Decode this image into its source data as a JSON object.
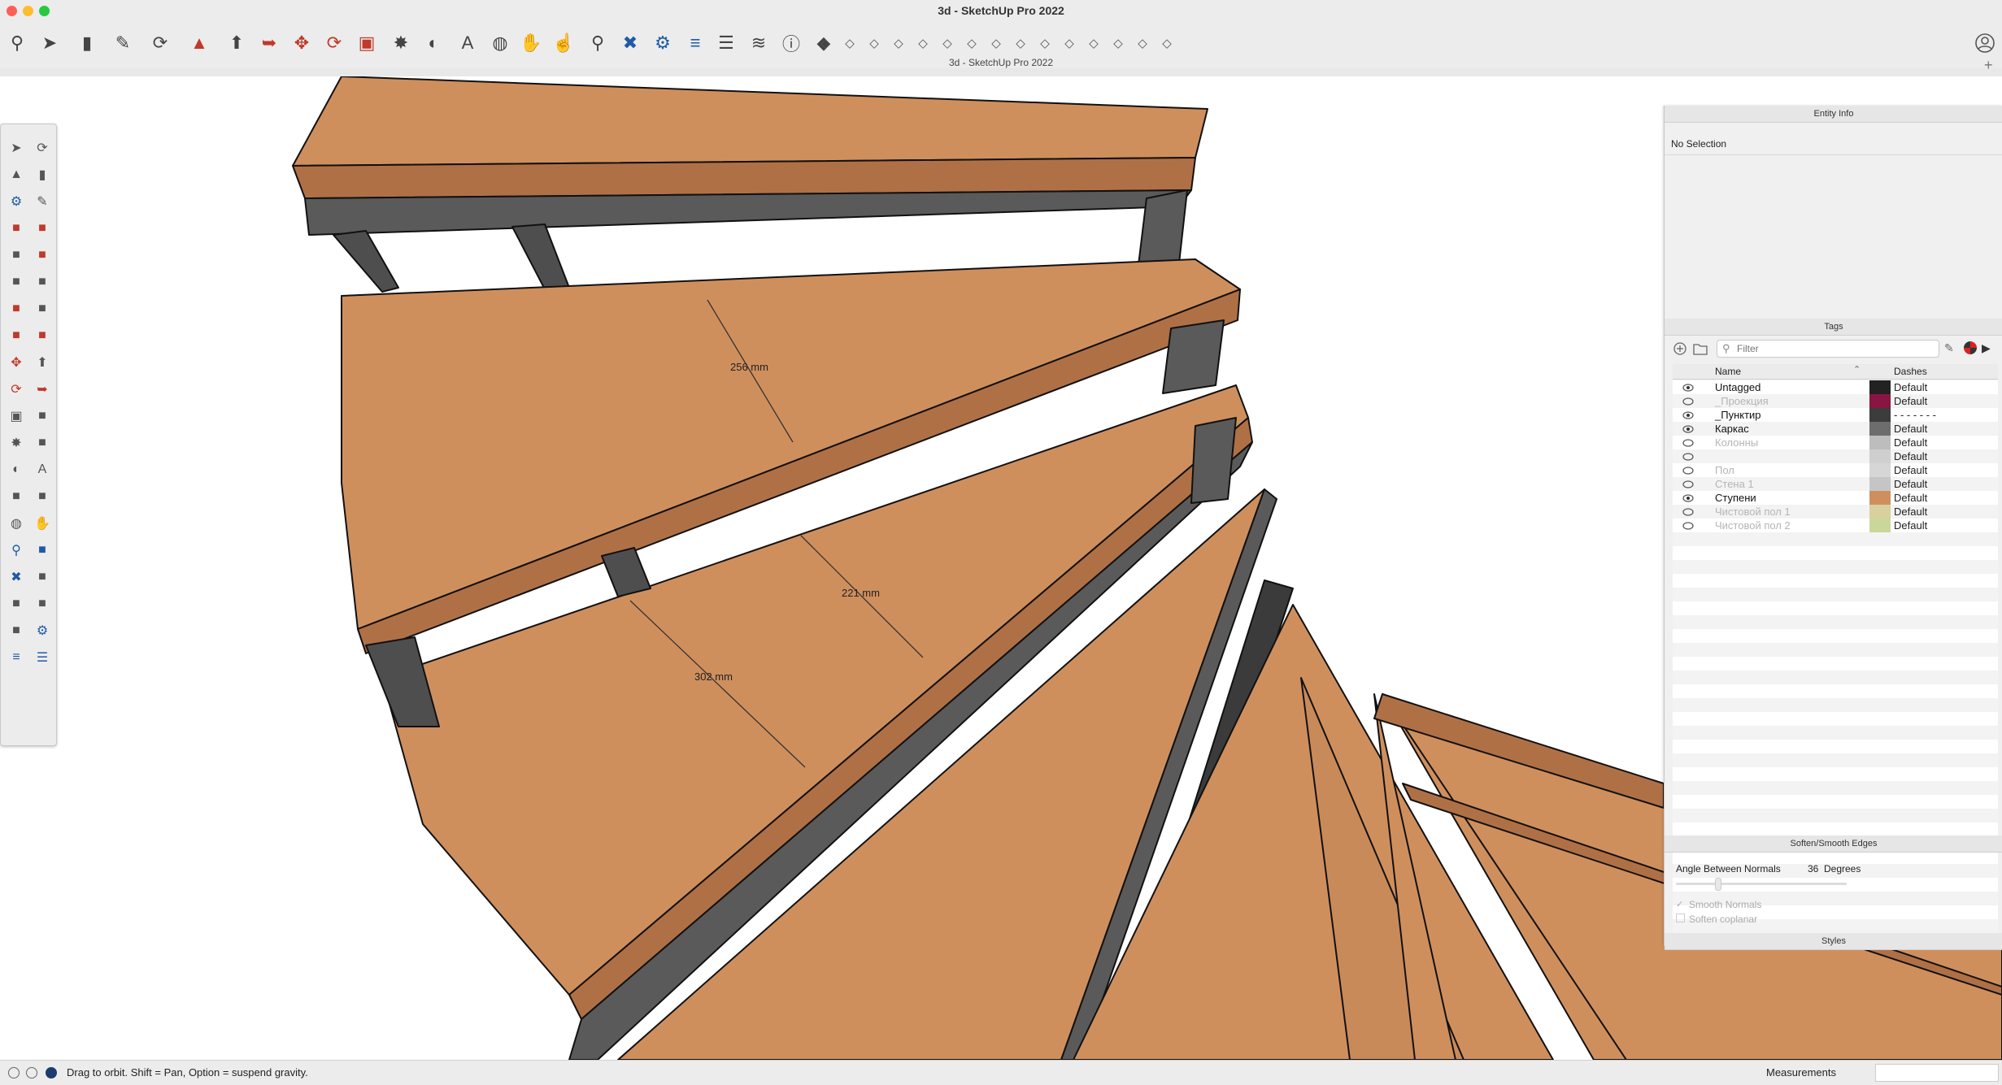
{
  "window": {
    "title": "3d - SketchUp Pro 2022",
    "doc_title": "3d - SketchUp Pro 2022"
  },
  "toolbar": {
    "icons": [
      "search-icon",
      "select-icon",
      "eraser-icon",
      "pencil-icon",
      "lasso-icon",
      "paint-bucket-icon",
      "push-pull-icon",
      "follow-me-icon",
      "move-icon",
      "rotate-icon",
      "scale-icon",
      "tape-measure-icon",
      "protractor-icon",
      "text-icon",
      "orbit-icon",
      "pan-icon",
      "hand-icon",
      "zoom-icon",
      "zoom-extents-icon",
      "warehouse-icon",
      "layers-icon",
      "stack-icon",
      "sections-icon",
      "info-icon",
      "shadow-icon"
    ]
  },
  "viewport": {
    "dimensions": [
      "256 mm",
      "221 mm",
      "302 mm"
    ],
    "colors": {
      "tread": "#cf8f5d",
      "tread_side": "#b07046",
      "frame": "#5a5a5a",
      "frame_dark": "#3b3b3b"
    }
  },
  "entity_info": {
    "header": "Entity Info",
    "status": "No Selection"
  },
  "tags": {
    "header": "Tags",
    "filter_placeholder": "Filter",
    "col_name": "Name",
    "col_dashes": "Dashes",
    "rows": [
      {
        "name": "Untagged",
        "dash": "Default",
        "visible": true,
        "color": "#222222"
      },
      {
        "name": "_Проекция",
        "dash": "Default",
        "visible": false,
        "color": "#8a1542"
      },
      {
        "name": "_Пунктир",
        "dash": "- - - - - - -",
        "visible": true,
        "color": "#3c3c3c"
      },
      {
        "name": "Каркас",
        "dash": "Default",
        "visible": true,
        "color": "#6d6d6d"
      },
      {
        "name": "Колонны",
        "dash": "Default",
        "visible": false,
        "color": "#bdbdbd"
      },
      {
        "name": "",
        "dash": "Default",
        "visible": false,
        "color": "#cfcfcf"
      },
      {
        "name": "Пол",
        "dash": "Default",
        "visible": false,
        "color": "#d6d6d6"
      },
      {
        "name": "Стена 1",
        "dash": "Default",
        "visible": false,
        "color": "#c5c5c5"
      },
      {
        "name": "Ступени",
        "dash": "Default",
        "visible": true,
        "color": "#cf8f5d"
      },
      {
        "name": "Чистовой пол 1",
        "dash": "Default",
        "visible": false,
        "color": "#d8d09f"
      },
      {
        "name": "Чистовой пол 2",
        "dash": "Default",
        "visible": false,
        "color": "#c9d89a"
      }
    ]
  },
  "soften": {
    "header": "Soften/Smooth Edges",
    "angle_label": "Angle Between Normals",
    "angle_value": "36",
    "angle_unit": "Degrees",
    "smooth_normals": "Smooth Normals",
    "soften_coplanar": "Soften coplanar"
  },
  "styles": {
    "header": "Styles"
  },
  "status": {
    "hint": "Drag to orbit. Shift = Pan, Option = suspend gravity.",
    "measurements_label": "Measurements"
  }
}
